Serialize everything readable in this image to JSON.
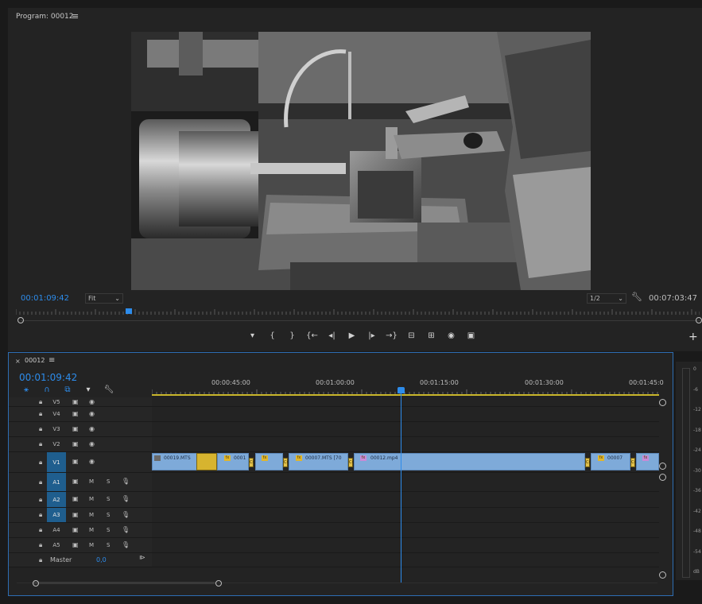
{
  "program": {
    "title": "Program: 00012",
    "menu_icon": "≡",
    "timecode_current": "00:01:09:42",
    "zoom_select": "Fit",
    "resolution_select": "1/2",
    "timecode_duration": "00:07:03:47"
  },
  "transport": {
    "buttons": [
      "marker-icon",
      "mark-in-icon",
      "mark-out-icon",
      "go-to-in-icon",
      "step-back-icon",
      "play-icon",
      "step-forward-icon",
      "go-to-out-icon",
      "lift-icon",
      "extract-icon",
      "export-frame-icon",
      "comparison-view-icon"
    ],
    "glyphs": [
      "▾",
      "{",
      "}",
      "{←",
      "◂|",
      "▶",
      "|▸",
      "→}",
      "⊟",
      "⊞",
      "◉",
      "▣"
    ]
  },
  "timeline": {
    "tab_close": "×",
    "tab_title": "00012",
    "tab_menu": "≡",
    "timecode": "00:01:09:42",
    "ruler_labels": [
      "00:00:45:00",
      "00:01:00:00",
      "00:01:15:00",
      "00:01:30:00",
      "00:01:45:0"
    ],
    "video_tracks": [
      "V5",
      "V4",
      "V3",
      "V2",
      "V1"
    ],
    "audio_tracks": [
      "A1",
      "A2",
      "A3",
      "A4",
      "A5"
    ],
    "mute_label": "M",
    "solo_label": "S",
    "master_label": "Master",
    "master_value": "0,0",
    "clips": [
      "00019.MTS",
      "0001",
      "00007.MTS [70",
      "00012.mp4",
      "00007"
    ],
    "fx_label": "fx",
    "transition_label": "Cr"
  },
  "meters": {
    "db_labels": [
      "0",
      "-6",
      "-12",
      "-18",
      "-24",
      "-30",
      "-36",
      "-42",
      "-48",
      "-54",
      "dB"
    ]
  },
  "colors": {
    "accent": "#2d8ceb",
    "clip": "#7eaad9",
    "fx": "#e0b62c",
    "work_area": "#c8b52a",
    "active_track": "#1f5e8e"
  }
}
